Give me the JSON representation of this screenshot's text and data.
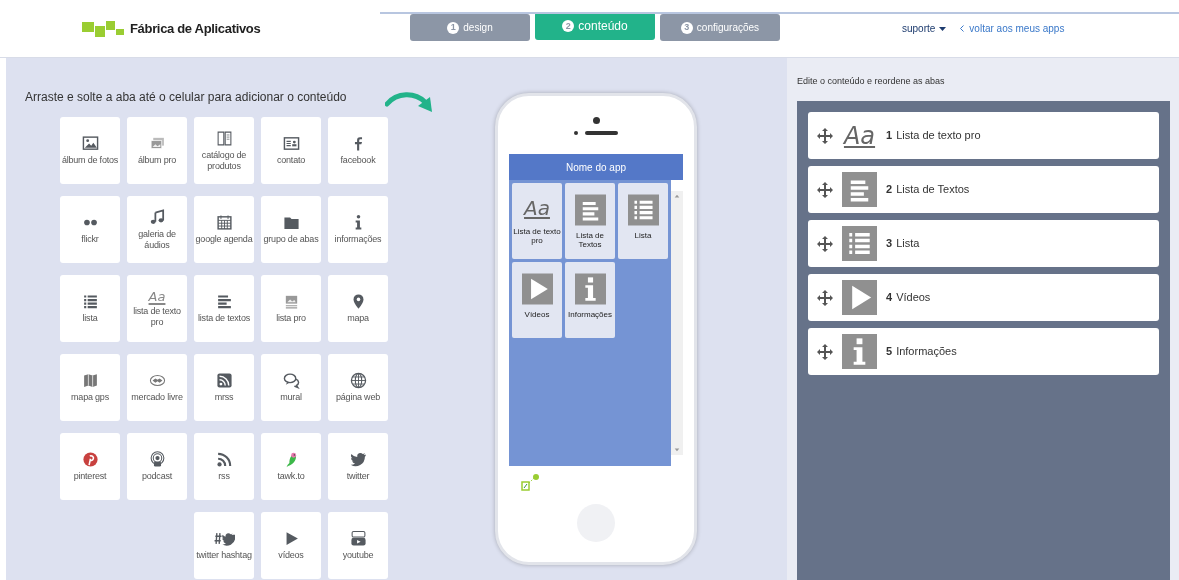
{
  "header": {
    "brand": "Fábrica de Aplicativos",
    "steps": [
      {
        "number": "1",
        "label": "design",
        "selected": false
      },
      {
        "number": "2",
        "label": "conteúdo",
        "selected": true
      },
      {
        "number": "3",
        "label": "configurações",
        "selected": false
      }
    ],
    "account": "suporte",
    "back_link": "voltar aos meus apps"
  },
  "library": {
    "title": "Arraste e solte a aba até o celular para adicionar o conteúdo",
    "tiles": [
      {
        "label": "álbum de fotos"
      },
      {
        "label": "álbum pro"
      },
      {
        "label": "catálogo de produtos"
      },
      {
        "label": "contato"
      },
      {
        "label": "facebook"
      },
      {
        "label": "flickr"
      },
      {
        "label": "galeria de áudios"
      },
      {
        "label": "google agenda"
      },
      {
        "label": "grupo de abas"
      },
      {
        "label": "informações"
      },
      {
        "label": "lista"
      },
      {
        "label": "lista de texto pro",
        "glyph": "Aa"
      },
      {
        "label": "lista de textos"
      },
      {
        "label": "lista pro"
      },
      {
        "label": "mapa"
      },
      {
        "label": "mapa gps"
      },
      {
        "label": "mercado livre"
      },
      {
        "label": "mrss"
      },
      {
        "label": "mural"
      },
      {
        "label": "página web"
      },
      {
        "label": "pinterest"
      },
      {
        "label": "podcast"
      },
      {
        "label": "rss"
      },
      {
        "label": "tawk.to"
      },
      {
        "label": "twitter"
      },
      {
        "label": "twitter hashtag"
      },
      {
        "label": "vídeos"
      },
      {
        "label": "youtube"
      }
    ]
  },
  "phone": {
    "app_title": "Nome do app",
    "tabs": [
      {
        "label": "Lista de texto pro",
        "glyph": "Aa"
      },
      {
        "label": "Lista de Textos"
      },
      {
        "label": "Lista"
      },
      {
        "label": "Vídeos"
      },
      {
        "label": "Informações"
      }
    ]
  },
  "editor": {
    "title": "Edite o conteúdo e reordene as abas",
    "rows": [
      {
        "number": "1",
        "label": "Lista de texto pro",
        "glyph": "Aa"
      },
      {
        "number": "2",
        "label": "Lista de Textos"
      },
      {
        "number": "3",
        "label": "Lista"
      },
      {
        "number": "4",
        "label": "Vídeos"
      },
      {
        "number": "5",
        "label": "Informações"
      }
    ]
  }
}
